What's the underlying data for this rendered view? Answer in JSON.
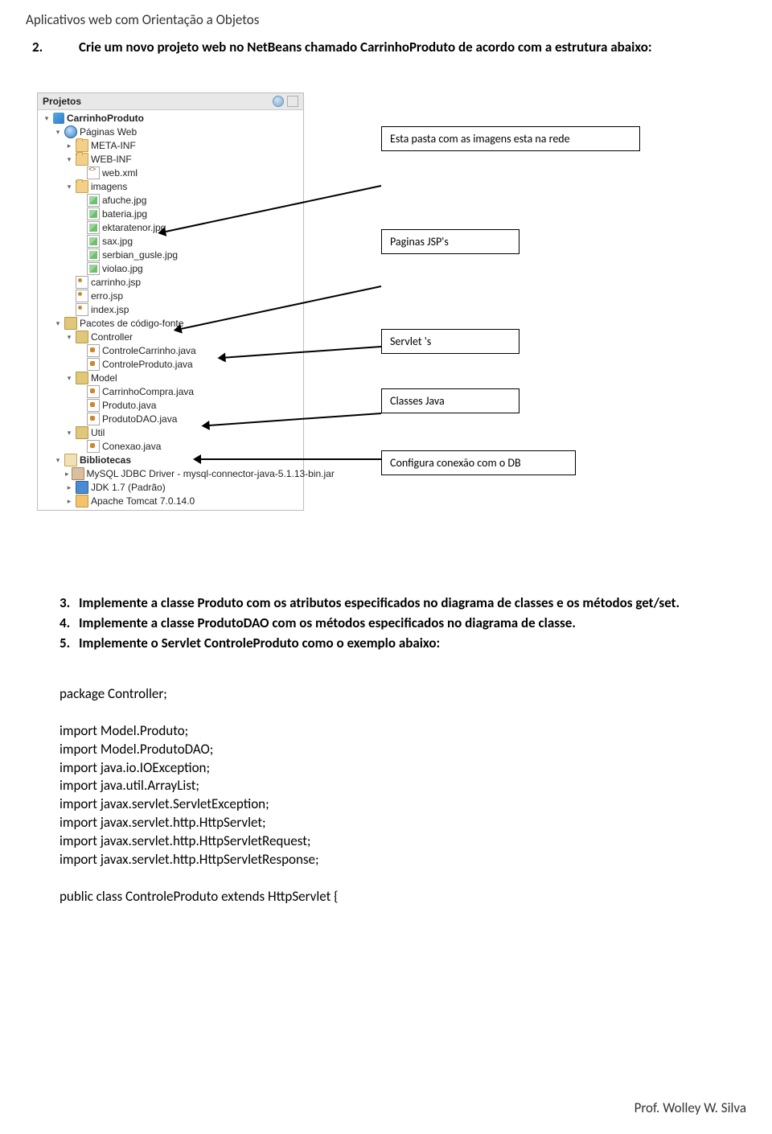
{
  "header": "Aplicativos web com Orientação a Objetos",
  "item2_num": "2.",
  "item2_text": "Crie um novo projeto web no NetBeans chamado CarrinhoProduto de acordo com a estrutura abaixo:",
  "callouts": {
    "c1": "Esta pasta com as imagens esta na rede",
    "c2": "Paginas JSP's",
    "c3": "Servlet 's",
    "c4": "Classes Java",
    "c5": "Configura conexão com o DB"
  },
  "projects_panel": {
    "title": "Projetos",
    "tree": {
      "root": "CarrinhoProduto",
      "paginas_web": "Páginas Web",
      "meta_inf": "META-INF",
      "web_inf": "WEB-INF",
      "web_xml": "web.xml",
      "imagens": "imagens",
      "img_files": [
        "afuche.jpg",
        "bateria.jpg",
        "ektaratenor.jpg",
        "sax.jpg",
        "serbian_gusle.jpg",
        "violao.jpg"
      ],
      "jsp_files": [
        "carrinho.jsp",
        "erro.jsp",
        "index.jsp"
      ],
      "pacotes": "Pacotes de código-fonte",
      "controller": "Controller",
      "controller_files": [
        "ControleCarrinho.java",
        "ControleProduto.java"
      ],
      "model": "Model",
      "model_files": [
        "CarrinhoCompra.java",
        "Produto.java",
        "ProdutoDAO.java"
      ],
      "util": "Util",
      "util_files": [
        "Conexao.java"
      ],
      "bibliotecas": "Bibliotecas",
      "libs": [
        "MySQL JDBC Driver - mysql-connector-java-5.1.13-bin.jar",
        "JDK 1.7 (Padrão)",
        "Apache Tomcat 7.0.14.0"
      ]
    }
  },
  "list2": {
    "i3": {
      "n": "3.",
      "t": "Implemente a classe Produto com os atributos especificados no diagrama de classes e os métodos get/set."
    },
    "i4": {
      "n": "4.",
      "t": "Implemente a classe ProdutoDAO com os métodos especificados no diagrama de classe."
    },
    "i5": {
      "n": "5.",
      "t": "Implemente o Servlet ControleProduto como o exemplo abaixo:"
    }
  },
  "code": {
    "pkg": "package Controller;",
    "imports": [
      "import Model.Produto;",
      "import Model.ProdutoDAO;",
      "import java.io.IOException;",
      "import java.util.ArrayList;",
      "import javax.servlet.ServletException;",
      "import javax.servlet.http.HttpServlet;",
      "import javax.servlet.http.HttpServletRequest;",
      "import javax.servlet.http.HttpServletResponse;"
    ],
    "class_decl": "public class ControleProduto extends HttpServlet {"
  },
  "footer": "Prof. Wolley W. Silva"
}
